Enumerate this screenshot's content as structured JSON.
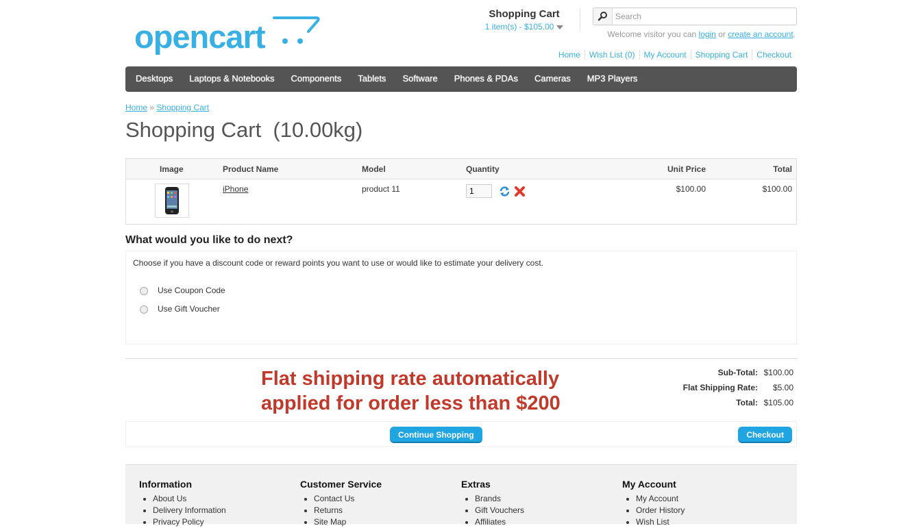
{
  "logo": {
    "text": "opencart"
  },
  "cart_widget": {
    "title": "Shopping Cart",
    "summary": "1 item(s) - $105.00"
  },
  "search": {
    "placeholder": "Search"
  },
  "welcome": {
    "prefix": "Welcome visitor you can",
    "login": "login",
    "or": "or",
    "create_account": "create an account",
    "suffix": "."
  },
  "top_links": [
    "Home",
    "Wish List (0)",
    "My Account",
    "Shopping Cart",
    "Checkout"
  ],
  "menu": [
    "Desktops",
    "Laptops & Notebooks",
    "Components",
    "Tablets",
    "Software",
    "Phones & PDAs",
    "Cameras",
    "MP3 Players"
  ],
  "breadcrumb": {
    "home": "Home",
    "separator": "»",
    "current": "Shopping Cart"
  },
  "page_title": "Shopping Cart  (10.00kg)",
  "cart_table": {
    "headers": {
      "image": "Image",
      "name": "Product Name",
      "model": "Model",
      "quantity": "Quantity",
      "unit_price": "Unit Price",
      "total": "Total"
    },
    "rows": [
      {
        "name": "iPhone",
        "model": "product 11",
        "quantity": "1",
        "unit_price": "$100.00",
        "total": "$100.00"
      }
    ]
  },
  "next": {
    "heading": "What would you like to do next?",
    "description": "Choose if you have a discount code or reward points you want to use or would like to estimate your delivery cost.",
    "options": [
      "Use Coupon Code",
      "Use Gift Voucher"
    ]
  },
  "totals": [
    {
      "label": "Sub-Total:",
      "value": "$100.00"
    },
    {
      "label": "Flat Shipping Rate:",
      "value": "$5.00"
    },
    {
      "label": "Total:",
      "value": "$105.00"
    }
  ],
  "annotation": {
    "line1": "Flat shipping rate automatically",
    "line2": "applied for order less than $200"
  },
  "buttons": {
    "continue": "Continue Shopping",
    "checkout": "Checkout"
  },
  "footer": [
    {
      "title": "Information",
      "links": [
        "About Us",
        "Delivery Information",
        "Privacy Policy"
      ]
    },
    {
      "title": "Customer Service",
      "links": [
        "Contact Us",
        "Returns",
        "Site Map"
      ]
    },
    {
      "title": "Extras",
      "links": [
        "Brands",
        "Gift Vouchers",
        "Affiliates"
      ]
    },
    {
      "title": "My Account",
      "links": [
        "My Account",
        "Order History",
        "Wish List"
      ]
    }
  ],
  "colors": {
    "accent": "#38B0E3",
    "menu_bg": "#545454",
    "button": "#1EA5E2",
    "annotation": "#C0392B",
    "footer_bg": "#F1F1F1"
  }
}
